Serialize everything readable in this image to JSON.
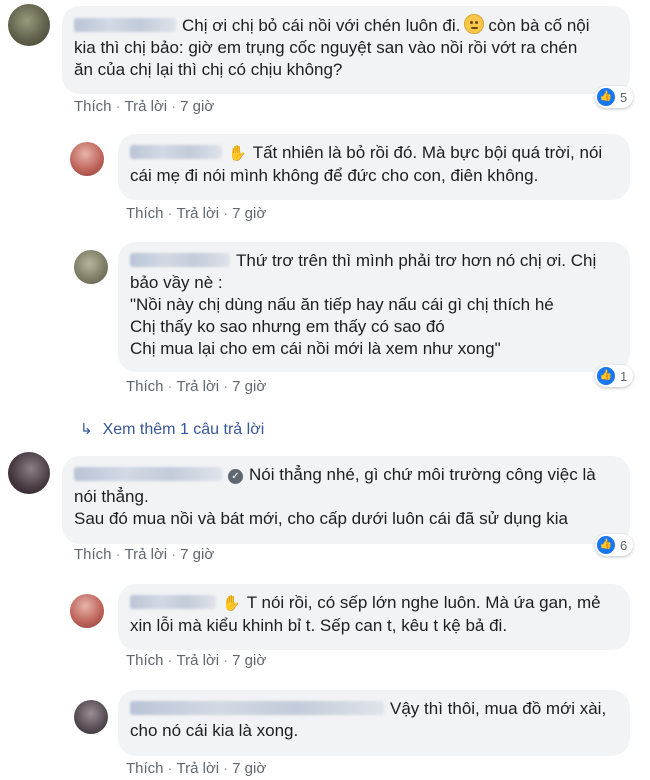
{
  "comments": [
    {
      "text_l1": "Chị ơi chị bỏ cái nồi với chén luôn đi.",
      "text_l1b": "còn bà cố nội",
      "text_l2": "kia thì chị bảo: giờ em trụng cốc nguyệt san vào nồi rồi vớt ra chén",
      "text_l3": "ăn của chị lại thì chị có chịu không?",
      "like": "Thích",
      "reply": "Trả lời",
      "time": "7 giờ",
      "reactions": "5"
    },
    {
      "text_l1": "Tất nhiên là bỏ rồi đó. Mà bực bội quá trời, nói",
      "text_l2": "cái mẹ đi nói mình không để đức cho con, điên không.",
      "like": "Thích",
      "reply": "Trả lời",
      "time": "7 giờ"
    },
    {
      "text_l1": "Thứ trơ trên thì mình phải trơ hơn nó chị ơi. Chị",
      "text_l2": "bảo vầy nè :",
      "text_l3": "\"Nồi này chị dùng nấu ăn tiếp hay nấu cái gì chị thích hé",
      "text_l4": "Chị thấy ko sao nhưng em thấy có sao đó",
      "text_l5": "Chị mua lại cho em cái nồi mới là xem như xong\"",
      "like": "Thích",
      "reply": "Trả lời",
      "time": "7 giờ",
      "reactions": "1"
    },
    {
      "text_l1": "Nói thẳng nhé, gì chứ môi trường công việc là",
      "text_l2": "nói thẳng.",
      "text_l3": "Sau đó mua nồi và bát mới, cho cấp dưới luôn cái đã sử dụng kia",
      "like": "Thích",
      "reply": "Trả lời",
      "time": "7 giờ",
      "reactions": "6"
    },
    {
      "text_l1": "T nói rồi, có sếp lớn nghe luôn. Mà ứa gan, mẻ",
      "text_l2": "xin lỗi mà kiểu khinh bỉ t. Sếp can t, kêu t kệ bả đi.",
      "like": "Thích",
      "reply": "Trả lời",
      "time": "7 giờ"
    },
    {
      "text_l1": "Vậy thì thôi, mua đồ mới xài,",
      "text_l2": "cho nó cái kia là xong.",
      "like": "Thích",
      "reply": "Trả lời",
      "time": "7 giờ"
    }
  ],
  "more_replies": "Xem thêm 1 câu trả lời",
  "colors": {
    "bubble": "#f2f3f5",
    "link": "#385898",
    "like_blue": "#1877f2",
    "meta": "#606770"
  }
}
